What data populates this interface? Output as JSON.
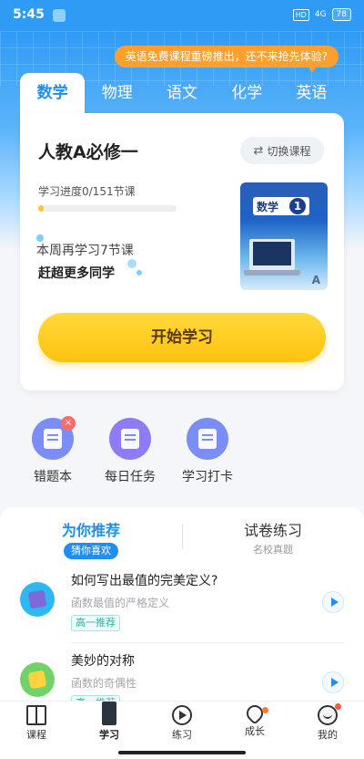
{
  "status_bar": {
    "time": "5:45",
    "hd": "HD",
    "signal": "4G",
    "battery": "78"
  },
  "promo": {
    "text": "英语免费课程重磅推出，还不来抢先体验?"
  },
  "subject_tabs": [
    {
      "label": "数学",
      "active": true
    },
    {
      "label": "物理",
      "active": false
    },
    {
      "label": "语文",
      "active": false
    },
    {
      "label": "化学",
      "active": false
    },
    {
      "label": "英语",
      "active": false
    }
  ],
  "course": {
    "title": "人教A必修一",
    "switch_label": "切换课程",
    "progress_label": "学习进度0/151节课",
    "progress_value": 0,
    "weekly_line1": "本周再学习7节课",
    "weekly_line2": "赶超更多同学",
    "book_label": "数学",
    "book_number": "1",
    "book_mark": "A",
    "start_label": "开始学习"
  },
  "quick_actions": [
    {
      "label": "错题本",
      "icon": "wrong-questions-icon"
    },
    {
      "label": "每日任务",
      "icon": "daily-task-icon"
    },
    {
      "label": "学习打卡",
      "icon": "checkin-calendar-icon"
    }
  ],
  "recommend": {
    "tab_left": "为你推荐",
    "tab_left_pill": "猜你喜欢",
    "tab_right": "试卷练习",
    "tab_right_sub": "名校真题",
    "items": [
      {
        "title": "如何写出最值的完美定义?",
        "subtitle": "函数最值的严格定义",
        "tag": "高一推荐"
      },
      {
        "title": "美妙的对称",
        "subtitle": "函数的奇偶性",
        "tag": "高一推荐"
      }
    ]
  },
  "bottom_nav": [
    {
      "label": "课程"
    },
    {
      "label": "学习"
    },
    {
      "label": "练习"
    },
    {
      "label": "成长"
    },
    {
      "label": "我的"
    }
  ],
  "colors": {
    "primary": "#1e8ef0",
    "accent_yellow": "#ffc20e",
    "promo": "#ff9f2e"
  }
}
